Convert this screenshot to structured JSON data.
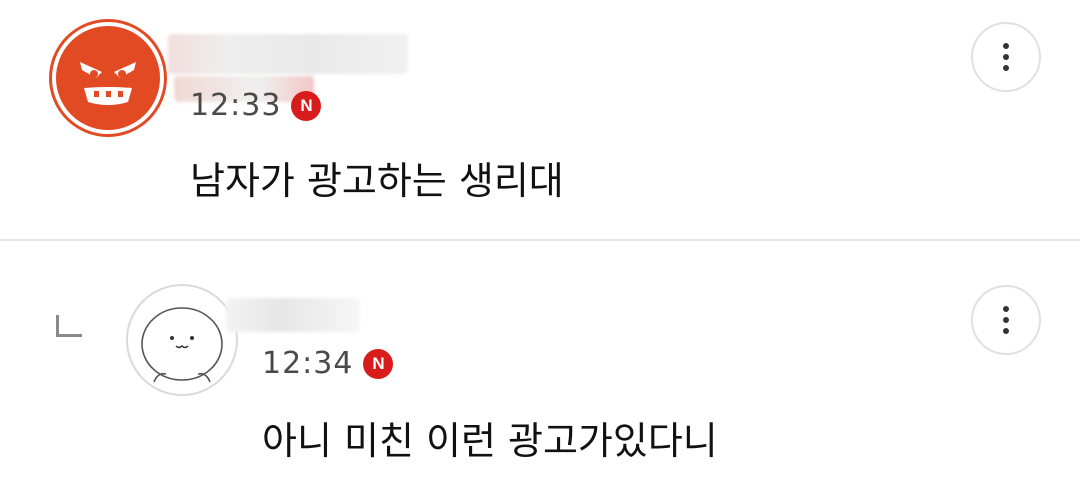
{
  "comments": [
    {
      "time": "12:33",
      "badge": "N",
      "text": "남자가 광고하는 생리대"
    },
    {
      "time": "12:34",
      "badge": "N",
      "text": "아니 미친 이런 광고가있다니"
    }
  ],
  "colors": {
    "badge_red": "#d81c1c",
    "avatar_red": "#e24a24",
    "divider": "#e6e6e6",
    "time_gray": "#4a4a4a"
  },
  "icons": {
    "more": "more-vertical-icon",
    "reply": "reply-arrow-icon"
  }
}
